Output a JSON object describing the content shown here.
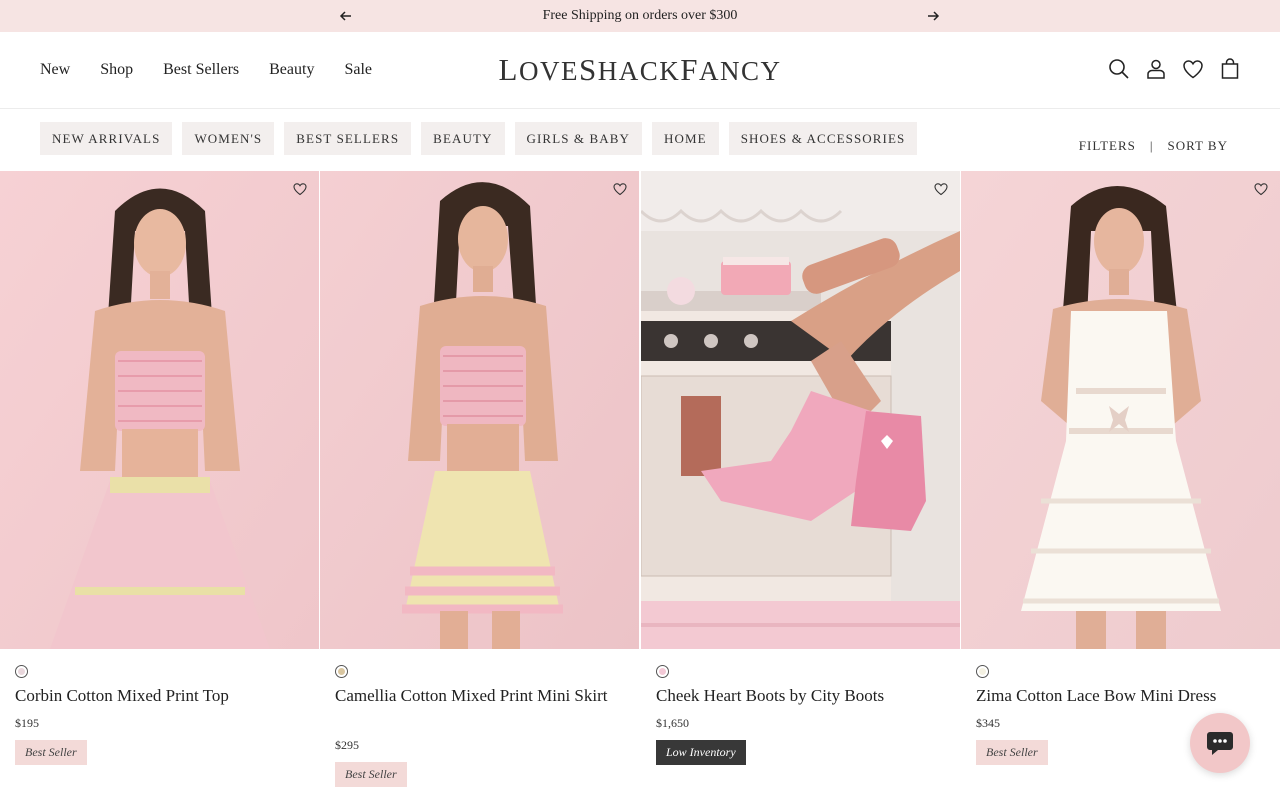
{
  "announcement": {
    "text": "Free Shipping on orders over $300",
    "prev_icon": "arrow-left-icon",
    "next_icon": "arrow-right-icon"
  },
  "nav": {
    "items": [
      "New",
      "Shop",
      "Best Sellers",
      "Beauty",
      "Sale"
    ]
  },
  "brand": {
    "logo_text": "LoveShackFancy"
  },
  "header_icons": [
    "search-icon",
    "account-icon",
    "wishlist-heart-icon",
    "shopping-bag-icon"
  ],
  "categories": [
    "NEW ARRIVALS",
    "WOMEN'S",
    "BEST SELLERS",
    "BEAUTY",
    "GIRLS & BABY",
    "HOME",
    "SHOES & ACCESSORIES"
  ],
  "toolbar": {
    "filters": "FILTERS",
    "separator": "|",
    "sort": "SORT BY"
  },
  "products": [
    {
      "name": "Corbin Cotton Mixed Print Top",
      "price": "$195",
      "badge": "Best Seller",
      "badge_style": "soft",
      "swatch_color": "#e9d7dc"
    },
    {
      "name": "Camellia Cotton Mixed Print Mini Skirt",
      "price": "$295",
      "badge": "Best Seller",
      "badge_style": "soft",
      "swatch_color": "#d9c6a0"
    },
    {
      "name": "Cheek Heart Boots by City Boots",
      "price": "$1,650",
      "badge": "Low Inventory",
      "badge_style": "dark",
      "swatch_color": "#f3c9d6"
    },
    {
      "name": "Zima Cotton Lace Bow Mini Dress",
      "price": "$345",
      "badge": "Best Seller",
      "badge_style": "soft",
      "swatch_color": "#f4f1e2"
    }
  ],
  "colors": {
    "announcement_bg": "#f6e4e3",
    "pill_bg": "#f3efee",
    "badge_soft": "#f3dad8",
    "badge_dark": "#383838",
    "chat_bg": "#f2c7c8"
  },
  "chat": {
    "icon": "chat-bubble-icon"
  }
}
